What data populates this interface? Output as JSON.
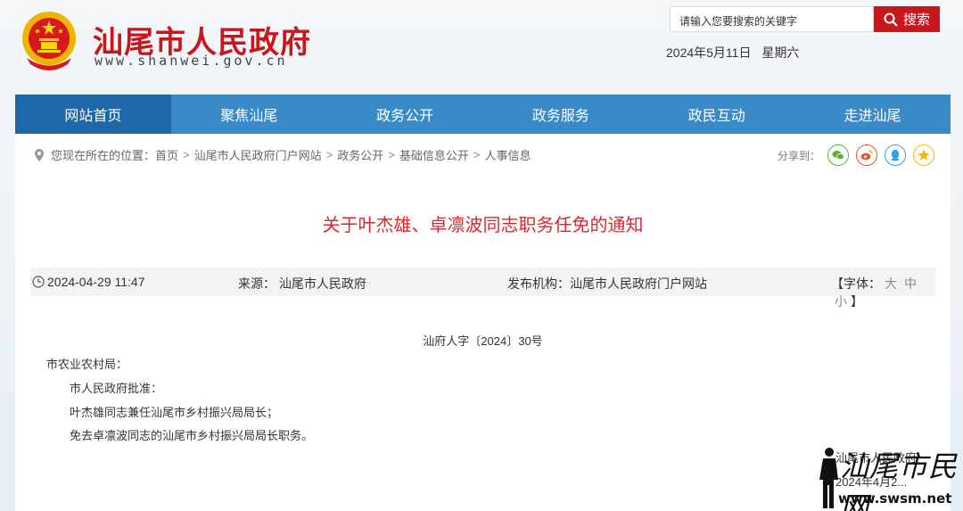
{
  "header": {
    "site_title": "汕尾市人民政府",
    "site_url": "www.shanwei.gov.cn",
    "search_placeholder": "请输入您要搜索的关键字",
    "search_button": "搜索",
    "date": "2024年5月11日",
    "weekday": "星期六"
  },
  "nav": {
    "items": [
      {
        "label": "网站首页"
      },
      {
        "label": "聚焦汕尾"
      },
      {
        "label": "政务公开"
      },
      {
        "label": "政务服务"
      },
      {
        "label": "政民互动"
      },
      {
        "label": "走进汕尾"
      }
    ]
  },
  "breadcrumb": {
    "prefix": "您现在所在的位置：",
    "items": [
      "首页",
      "汕尾市人民政府门户网站",
      "政务公开",
      "基础信息公开",
      "人事信息"
    ]
  },
  "share": {
    "label": "分享到：",
    "icons": [
      "wechat-icon",
      "weibo-icon",
      "qq-icon",
      "qzone-icon"
    ],
    "colors": {
      "wechat": "#5cb531",
      "weibo": "#e6532b",
      "qq": "#2ea5e6",
      "qzone": "#f5b800"
    }
  },
  "article": {
    "title": "关于叶杰雄、卓凛波同志职务任免的通知",
    "datetime": "2024-04-29 11:47",
    "source_label": "来源：",
    "source": "汕尾市人民政府",
    "publisher_label": "发布机构：",
    "publisher": "汕尾市人民政府门户网站",
    "font_label_open": "【字体：",
    "font_large": "大",
    "font_medium": "中",
    "font_small": "小",
    "font_label_close": "】",
    "doc_number": "汕府人字〔2024〕30号",
    "addressee": "市农业农村局：",
    "lines": [
      "市人民政府批准：",
      "叶杰雄同志兼任汕尾市乡村振兴局局长；",
      "免去卓凛波同志的汕尾市乡村振兴局局长职务。"
    ],
    "signature": "汕尾市人民政府",
    "sign_date": "2024年4月2..."
  },
  "watermark": {
    "script_text": "汕尾市民网",
    "url": "www.swsm.net"
  },
  "colors": {
    "brand_red": "#c8161d",
    "title_red": "#d8282d",
    "nav_blue": "#3a8ac8",
    "nav_active": "#1e67a8"
  }
}
